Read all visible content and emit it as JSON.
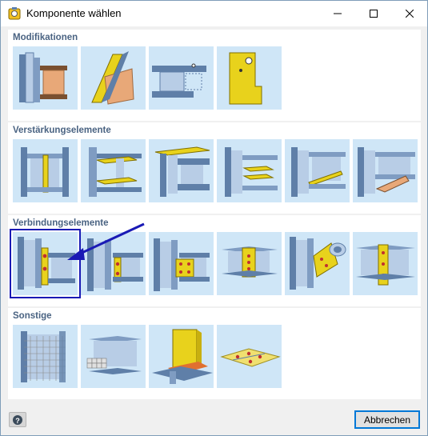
{
  "window": {
    "title": "Komponente wählen"
  },
  "titlebar_buttons": {
    "minimize_icon": "minimize-icon",
    "maximize_icon": "maximize-icon",
    "close_icon": "close-icon"
  },
  "groups": [
    {
      "title": "Modifikationen",
      "items": [
        "modification-column-beam",
        "modification-plate-cut",
        "modification-beam-end",
        "modification-plate-notch"
      ]
    },
    {
      "title": "Verstärkungselemente",
      "items": [
        "stiffener-web",
        "stiffener-flange-plates",
        "stiffener-column-web",
        "stiffener-end-plates",
        "stiffener-diagonal",
        "stiffener-haunch"
      ]
    },
    {
      "title": "Verbindungselemente",
      "items": [
        "end-plate-connection",
        "fin-plate-connection",
        "cleat-connection",
        "beam-splice",
        "gusset-connection",
        "splice-plate-connection"
      ],
      "selected_index": 0
    },
    {
      "title": "Sonstige",
      "items": [
        "mesh-column",
        "bolted-beam-grid",
        "base-plate-weld",
        "anchor-plate"
      ]
    }
  ],
  "footer": {
    "help_icon": "help-icon",
    "cancel_label": "Abbrechen"
  },
  "colors": {
    "steel": "#5f7fa8",
    "steel_light": "#b8cde6",
    "plate_yellow": "#e8d21c",
    "weld_orange": "#e07030",
    "thumb_bg": "#cfe6f7",
    "group_title": "#4a6382",
    "selection": "#1a1ab5"
  }
}
